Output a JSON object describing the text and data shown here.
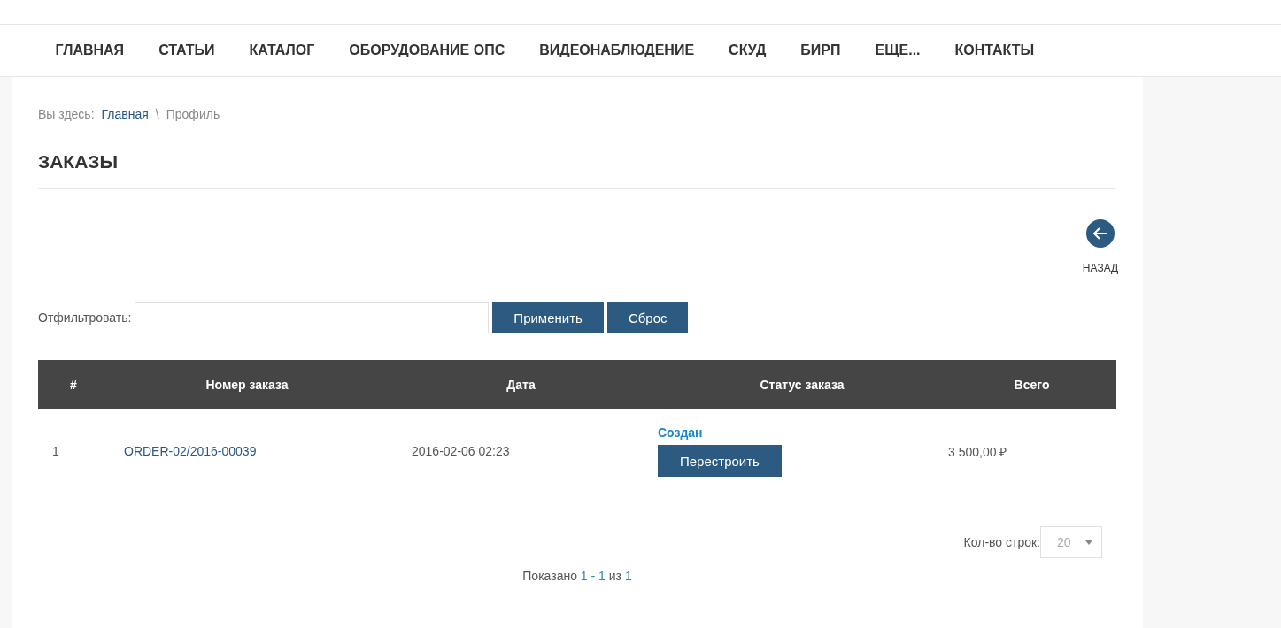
{
  "nav": [
    {
      "label": "ГЛАВНАЯ"
    },
    {
      "label": "СТАТЬИ"
    },
    {
      "label": "КАТАЛОГ"
    },
    {
      "label": "ОБОРУДОВАНИЕ ОПС"
    },
    {
      "label": "ВИДЕОНАБЛЮДЕНИЕ"
    },
    {
      "label": "СКУД"
    },
    {
      "label": "БИРП"
    },
    {
      "label": "ЕЩЕ..."
    },
    {
      "label": "КОНТАКТЫ"
    }
  ],
  "breadcrumb": {
    "prefix": "Вы здесь:",
    "items": [
      "Главная",
      "Профиль"
    ],
    "separator": "\\"
  },
  "heading": "ЗАКАЗЫ",
  "back": {
    "label": "НАЗАД"
  },
  "filter": {
    "label": "Отфильтровать:",
    "apply": "Применить",
    "reset": "Сброс"
  },
  "table": {
    "columns": [
      "#",
      "Номер заказа",
      "Дата",
      "Статус заказа",
      "Всего"
    ],
    "rows": [
      {
        "index": "1",
        "order": "ORDER-02/2016-00039",
        "date": "2016-02-06 02:23",
        "status": "Создан",
        "action": "Перестроить",
        "total": "3 500,00 ₽"
      }
    ]
  },
  "rows_per_page": {
    "label": "Кол-во строк:",
    "value": "20"
  },
  "pagination": {
    "label": "Показано",
    "from": "1",
    "dash": "-",
    "to": "1",
    "of": "из",
    "total": "1"
  }
}
